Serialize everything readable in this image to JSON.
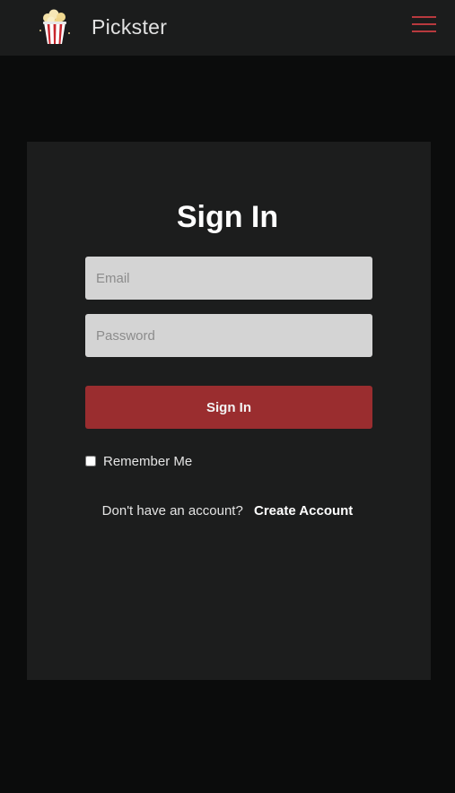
{
  "navbar": {
    "brand_name": "Pickster",
    "logo_icon": "popcorn-icon",
    "menu_icon": "hamburger-menu-icon",
    "accent_color": "#b8393e"
  },
  "signin": {
    "title": "Sign In",
    "email_placeholder": "Email",
    "password_placeholder": "Password",
    "submit_label": "Sign In",
    "remember_label": "Remember Me",
    "remember_checked": false,
    "no_account_text": "Don't have an account?",
    "create_account_label": "Create Account",
    "button_color": "#9a2d2f"
  }
}
